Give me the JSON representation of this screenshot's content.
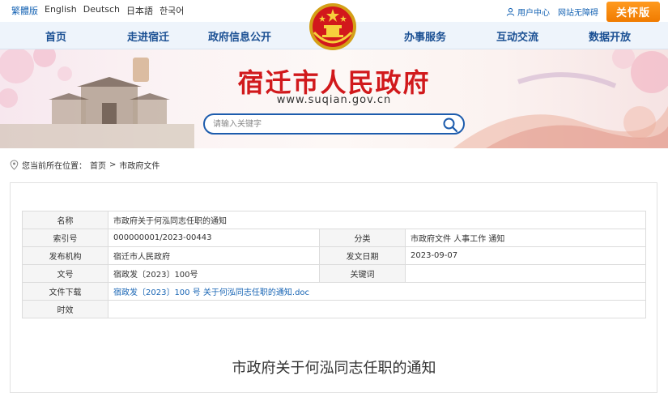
{
  "top": {
    "languages": [
      "繁體版",
      "English",
      "Deutsch",
      "日本語",
      "한국어"
    ],
    "user_center": "用户中心",
    "accessibility": "网站无障碍",
    "care_mode": "关怀版"
  },
  "nav": {
    "items": [
      "首页",
      "走进宿迁",
      "政府信息公开",
      "办事服务",
      "互动交流",
      "数据开放"
    ]
  },
  "banner": {
    "title": "宿迁市人民政府",
    "url": "www.suqian.gov.cn",
    "search_placeholder": "请输入关键字"
  },
  "breadcrumb": {
    "prefix": "您当前所在位置：",
    "home": "首页",
    "separator": ">",
    "current": "市政府文件"
  },
  "meta": {
    "name_label": "名称",
    "name_value": "市政府关于何泓同志任职的通知",
    "index_label": "索引号",
    "index_value": "000000001/2023-00443",
    "category_label": "分类",
    "category_value": "市政府文件   人事工作   通知",
    "issuer_label": "发布机构",
    "issuer_value": "宿迁市人民政府",
    "date_label": "发文日期",
    "date_value": "2023-09-07",
    "docno_label": "文号",
    "docno_value": "宿政发〔2023〕100号",
    "keywords_label": "关键词",
    "keywords_value": "",
    "download_label": "文件下载",
    "download_value": "宿政发〔2023〕100 号 关于何泓同志任职的通知.doc",
    "validity_label": "时效",
    "validity_value": ""
  },
  "document": {
    "title": "市政府关于何泓同志任职的通知"
  }
}
